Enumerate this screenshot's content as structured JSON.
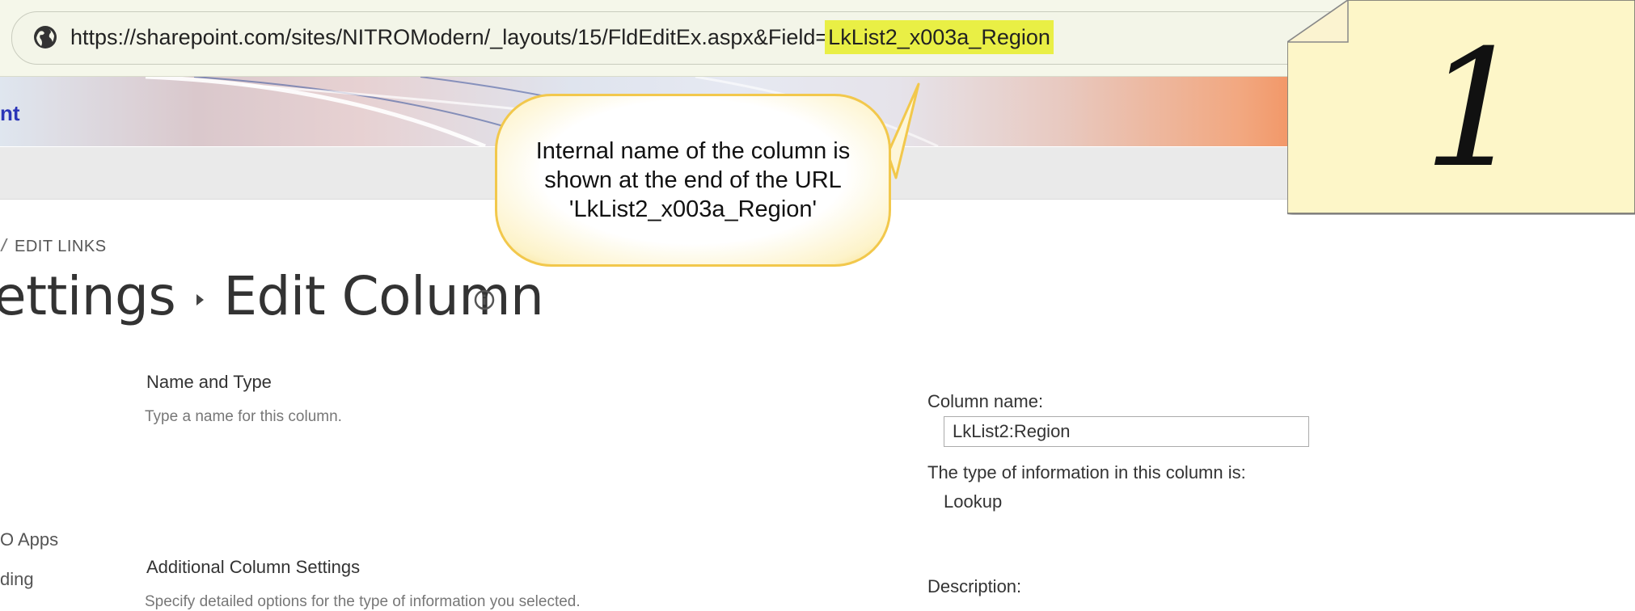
{
  "browser": {
    "url_prefix": "https://sharepoint.com/sites/NITROModern/_layouts/15/FldEditEx.aspx&Field=",
    "url_highlight": "LkList2_x003a_Region",
    "site_icon": "globe-icon"
  },
  "banner": {
    "site_title_fragment": "nt"
  },
  "nav": {
    "edit_links": "EDIT LINKS",
    "items": [
      "O Apps",
      "ding"
    ]
  },
  "page": {
    "breadcrumb_parent": "ettings",
    "title": "Edit Column",
    "info_icon": "info-icon"
  },
  "sections": {
    "name_and_type": {
      "title": "Name and Type",
      "description": "Type a name for this column."
    },
    "additional": {
      "title": "Additional Column Settings",
      "description": "Specify detailed options for the type of information you selected."
    }
  },
  "form": {
    "column_name_label": "Column name:",
    "column_name_value": "LkList2:Region",
    "type_label": "The type of information in this column is:",
    "type_value": "Lookup",
    "description_label": "Description:"
  },
  "annotation": {
    "callout_text": "Internal name of the column is shown at the end of the URL 'LkList2_x003a_Region'",
    "step_number": "1",
    "highlight_color": "#e9ef45",
    "callout_border_color": "#f2c84c",
    "note_color": "#fdf6c8"
  }
}
